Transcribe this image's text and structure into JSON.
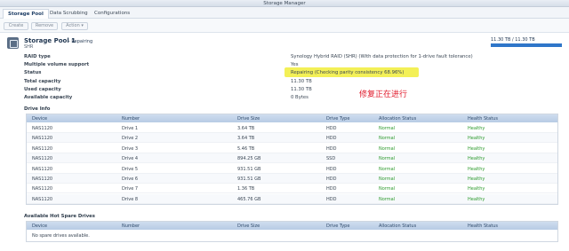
{
  "window": {
    "title": "Storage Manager"
  },
  "tabs": [
    "Storage Pool",
    "Data Scrubbing",
    "Configurations"
  ],
  "toolbar": {
    "create": "Create",
    "remove": "Remove",
    "action": "Action",
    "action_caret": "▾"
  },
  "pool": {
    "title": "Storage Pool 1",
    "status_suffix": "- Repairing",
    "subtitle": "SHR",
    "capacity_text": "11.30 TB / 11.30 TB",
    "capacity_fraction": 1.0
  },
  "info": [
    {
      "label": "RAID type",
      "value": "Synology Hybrid RAID (SHR) (With data protection for 1-drive fault tolerance)"
    },
    {
      "label": "Multiple volume support",
      "value": "Yes"
    },
    {
      "label": "Status",
      "value": "Repairing (Checking parity consistency 68.96%)"
    },
    {
      "label": "Total capacity",
      "value": "11.30 TB"
    },
    {
      "label": "Used capacity",
      "value": "11.30 TB"
    },
    {
      "label": "Available capacity",
      "value": "0 Bytes"
    }
  ],
  "annotation": "修复正在进行",
  "drive_info": {
    "title": "Drive Info",
    "columns": [
      "Device",
      "Number",
      "Drive Size",
      "Drive Type",
      "Allocation Status",
      "Health Status"
    ],
    "rows": [
      [
        "NAS1120",
        "Drive 1",
        "3.64 TB",
        "HDD",
        "Normal",
        "Healthy"
      ],
      [
        "NAS1120",
        "Drive 2",
        "3.64 TB",
        "HDD",
        "Normal",
        "Healthy"
      ],
      [
        "NAS1120",
        "Drive 3",
        "5.46 TB",
        "HDD",
        "Normal",
        "Healthy"
      ],
      [
        "NAS1120",
        "Drive 4",
        "894.25 GB",
        "SSD",
        "Normal",
        "Healthy"
      ],
      [
        "NAS1120",
        "Drive 5",
        "931.51 GB",
        "HDD",
        "Normal",
        "Healthy"
      ],
      [
        "NAS1120",
        "Drive 6",
        "931.51 GB",
        "HDD",
        "Normal",
        "Healthy"
      ],
      [
        "NAS1120",
        "Drive 7",
        "1.36 TB",
        "HDD",
        "Normal",
        "Healthy"
      ],
      [
        "NAS1120",
        "Drive 8",
        "465.76 GB",
        "HDD",
        "Normal",
        "Healthy"
      ]
    ]
  },
  "hot_spare": {
    "title": "Available Hot Spare Drives",
    "columns": [
      "Device",
      "Number",
      "Drive Size",
      "Drive Type",
      "Allocation Status",
      "Health Status"
    ],
    "empty_text": "No spare drives available."
  },
  "colors": {
    "accent": "#2f76c9",
    "healthy": "#2c9a2c",
    "highlight": "#f3f057",
    "annotation": "#e0192a"
  }
}
